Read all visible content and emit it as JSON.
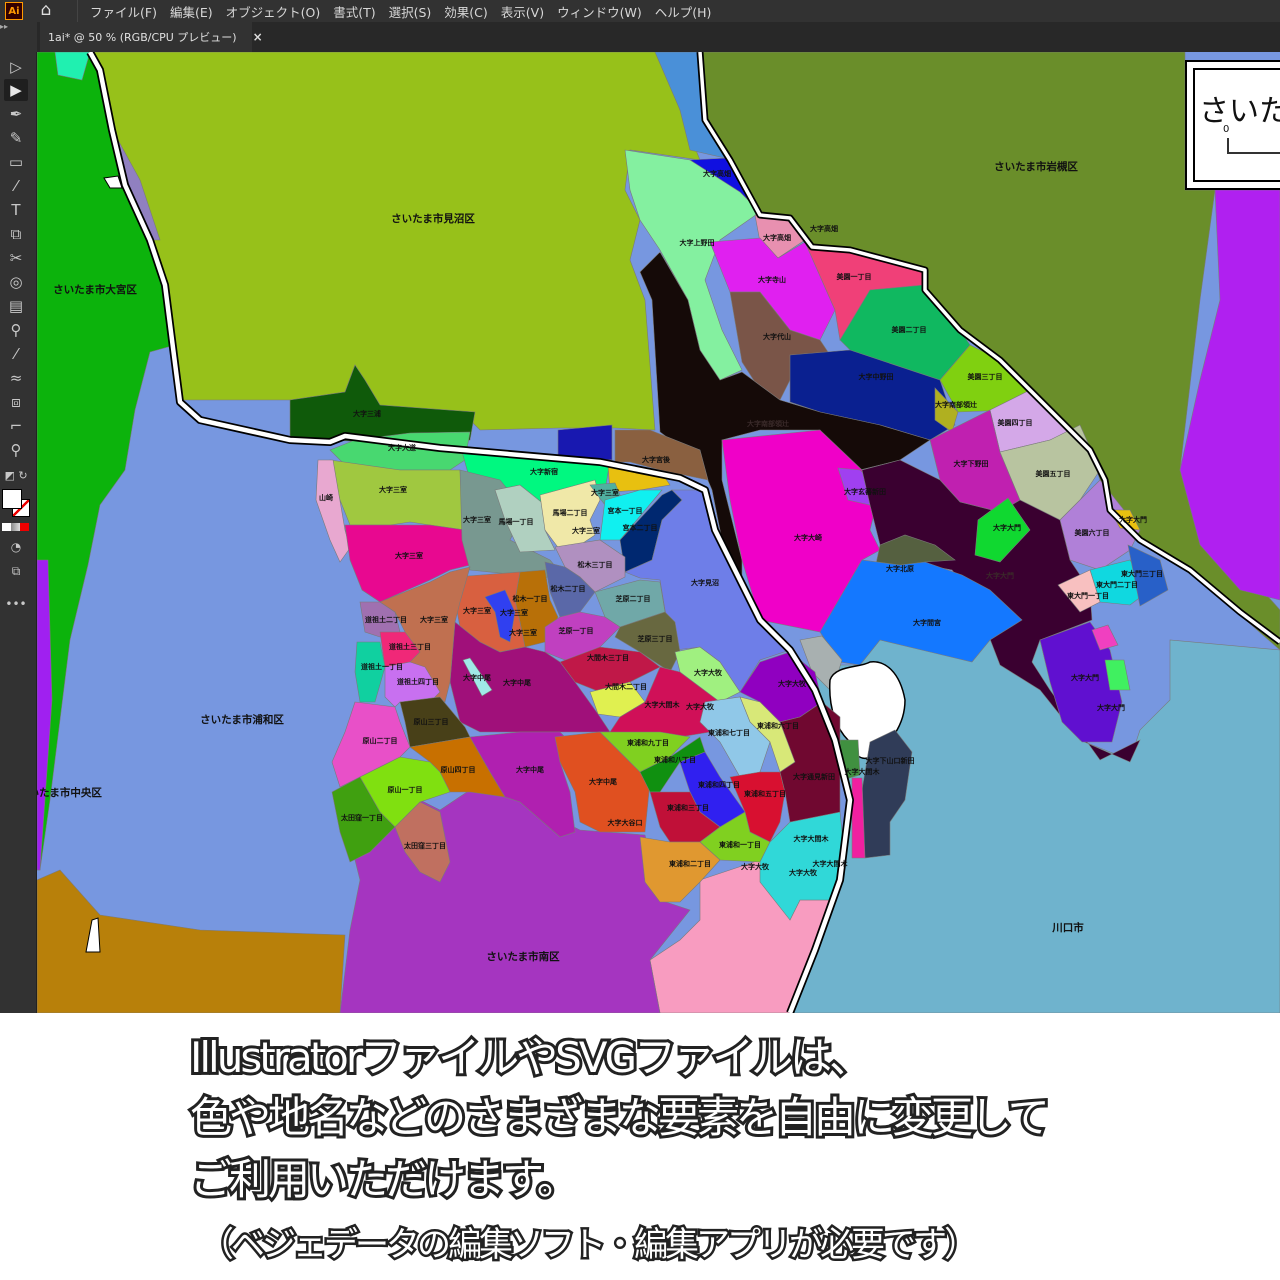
{
  "app": {
    "logo": "Ai",
    "menus": [
      "ファイル(F)",
      "編集(E)",
      "オブジェクト(O)",
      "書式(T)",
      "選択(S)",
      "効果(C)",
      "表示(V)",
      "ウィンドウ(W)",
      "ヘルプ(H)"
    ]
  },
  "tab": {
    "title": "1ai* @ 50 % (RGB/CPU プレビュー)",
    "close": "×"
  },
  "legend": {
    "title": "さいた",
    "scale_zero": "0"
  },
  "map": {
    "labels": [
      "さいたま市見沼区",
      "さいたま市岩槻区",
      "さいたま市大宮区",
      "さいたま市浦和区",
      "さいたま市中央区",
      "さいたま市南区",
      "川口市",
      "大字高畑",
      "大字高畑",
      "大字高畑",
      "大字上野田",
      "大字寺山",
      "美園一丁目",
      "美園二丁目",
      "大字代山",
      "大字中野田",
      "美園三丁目",
      "大字南部領辻",
      "美園四丁目",
      "大字南部領辻",
      "大字三浦",
      "大字宮後",
      "大字大道",
      "大字新宿",
      "大字三室",
      "大字三室",
      "宮本一丁目",
      "馬場二丁目",
      "大字三室",
      "馬場一丁目",
      "大字三室",
      "宮本二丁目",
      "山崎",
      "大字三室",
      "松木三丁目",
      "松木二丁目",
      "松木一丁目",
      "芝原二丁目",
      "大字三室",
      "大字三室",
      "大字三室",
      "道祖土二丁目",
      "芝原一丁目",
      "大字三室",
      "芝原三丁目",
      "道祖土三丁目",
      "道祖土一丁目",
      "大間木三丁目",
      "大字中尾",
      "大字中尾",
      "道祖土四丁目",
      "大間木二丁目",
      "大字大牧",
      "大字大牧",
      "大字大間木",
      "大字大牧",
      "原山三丁目",
      "東浦和六丁目",
      "東浦和七丁目",
      "原山二丁目",
      "東浦和九丁目",
      "東浦和八丁目",
      "大字中尾",
      "原山四丁目",
      "大字通見新田",
      "東浦和四丁目",
      "東浦和五丁目",
      "原山一丁目",
      "大字中尾",
      "東浦和三丁目",
      "太田窪一丁目",
      "大字大谷口",
      "大字大間木",
      "太田窪三丁目",
      "東浦和一丁目",
      "東浦和二丁目",
      "大字大牧",
      "大字大牧",
      "大字大間木",
      "大字下山口新田",
      "大字大間木",
      "大字下野田",
      "美園五丁目",
      "大字玄蕃新田",
      "大字大崎",
      "大字大門",
      "美園六丁目",
      "大字大門",
      "大字北原",
      "大字大門",
      "東大門三丁目",
      "東大門二丁目",
      "東大門一丁目",
      "大字間宮",
      "大字大門",
      "大字大門",
      "大字見沼"
    ]
  },
  "caption": {
    "line1": "IllustratorファイルやSVGファイルは、",
    "line2": "色や地名などのさまざまな要素を自由に変更して",
    "line3": "ご利用いただけます。",
    "line4": "（ベジェデータの編集ソフト・編集アプリが必要です）"
  }
}
